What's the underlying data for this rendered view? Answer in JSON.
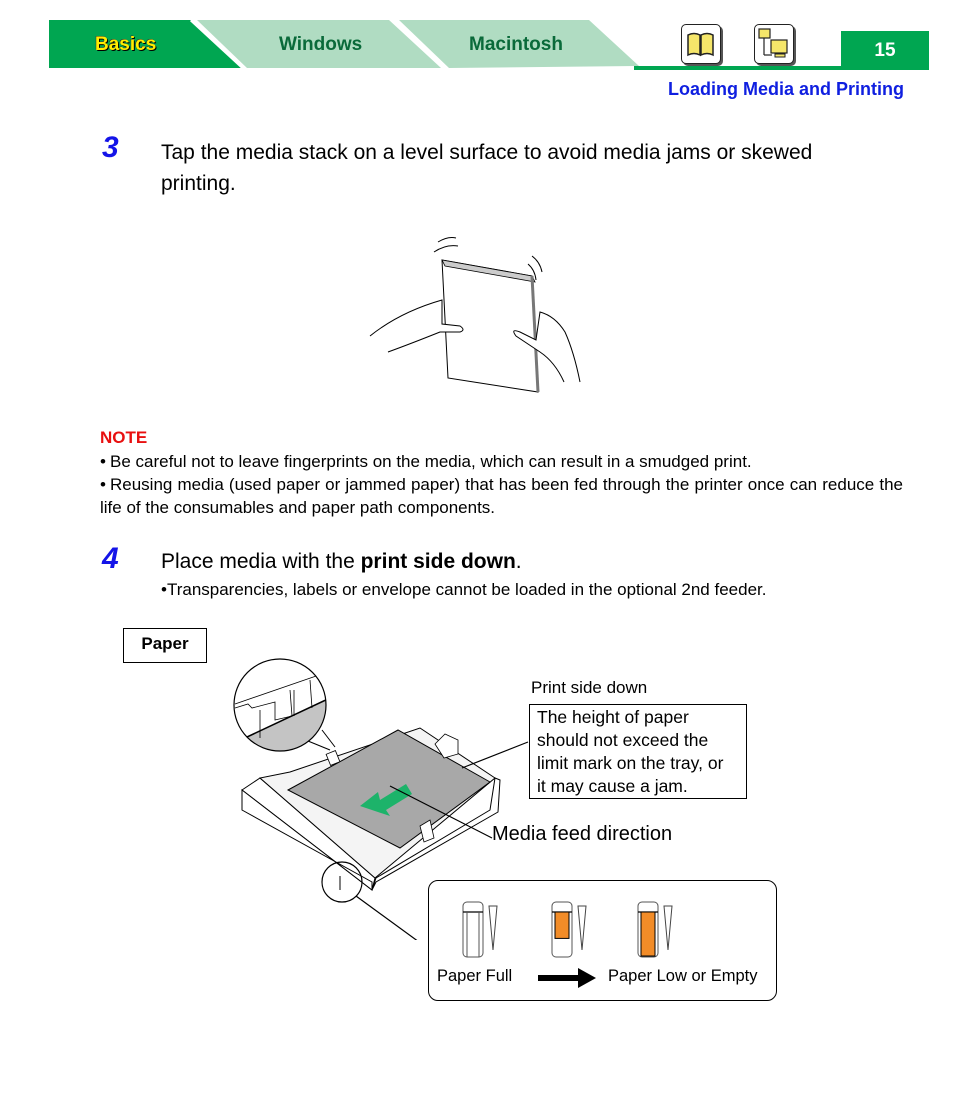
{
  "header": {
    "tabs": [
      {
        "label": "Basics",
        "active": true
      },
      {
        "label": "Windows",
        "active": false
      },
      {
        "label": "Macintosh",
        "active": false
      }
    ],
    "icons": [
      {
        "name": "book-icon",
        "label": "Manual"
      },
      {
        "name": "network-computer-icon",
        "label": "Network"
      }
    ],
    "page_number": "15",
    "section_title": "Loading Media and Printing",
    "colors": {
      "active_tab": "#00a651",
      "inactive_tab": "#b0dcc2",
      "active_tab_text": "#ffee00",
      "inactive_tab_text": "#0a6a3a",
      "section_title": "#0f1fe0"
    }
  },
  "steps": [
    {
      "number": "3",
      "text": "Tap the media stack on a level surface to avoid media jams or skewed printing.",
      "line1": "Tap the media stack on a level surface to avoid media jams or skewed",
      "line2": "printing."
    },
    {
      "number": "4",
      "text_before": "Place media with the ",
      "text_bold": "print side down",
      "text_after": ".",
      "sub_note": "•Transparencies, labels or envelope cannot be loaded in the optional 2nd feeder."
    }
  ],
  "note": {
    "title": "NOTE",
    "items": [
      "Be careful not to leave fingerprints on the media, which can result in a smudged print.",
      "Reusing media (used paper or jammed paper) that has been fed through the printer once can reduce the life of the consumables and paper path components."
    ]
  },
  "figure": {
    "paper_label": "Paper",
    "print_side_label": "Print side down",
    "height_note_lines": [
      "The height of paper",
      "should not exceed the",
      "limit mark on the tray, or",
      "it may cause a jam."
    ],
    "feed_direction_label": "Media feed direction",
    "indicator": {
      "full_label": "Paper Full",
      "low_label": "Paper Low or Empty",
      "levels": [
        0,
        0.6,
        1.0
      ],
      "fill_color": "#f28c28"
    },
    "arrow_color": "#1db36a"
  }
}
